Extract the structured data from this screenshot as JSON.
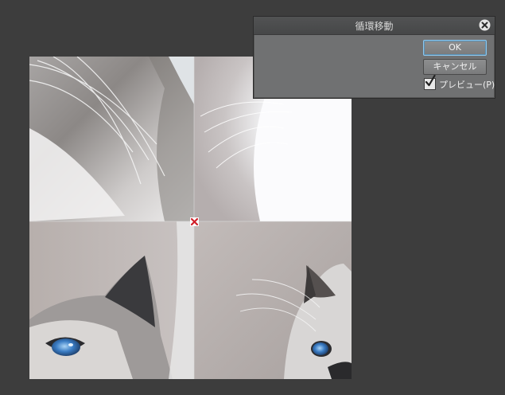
{
  "dialog": {
    "title": "循環移動",
    "ok_label": "OK",
    "cancel_label": "キャンセル",
    "preview_label": "プレビュー(P)",
    "preview_checked": true
  },
  "canvas": {
    "description_icon": "center-cross-marker-icon"
  },
  "colors": {
    "workspace_bg": "#3d3d3d",
    "dialog_bg": "#707172",
    "dialog_titlebar": "#4c4d4e",
    "ok_focus_border": "#8fc8ee",
    "marker": "#d0202a"
  }
}
